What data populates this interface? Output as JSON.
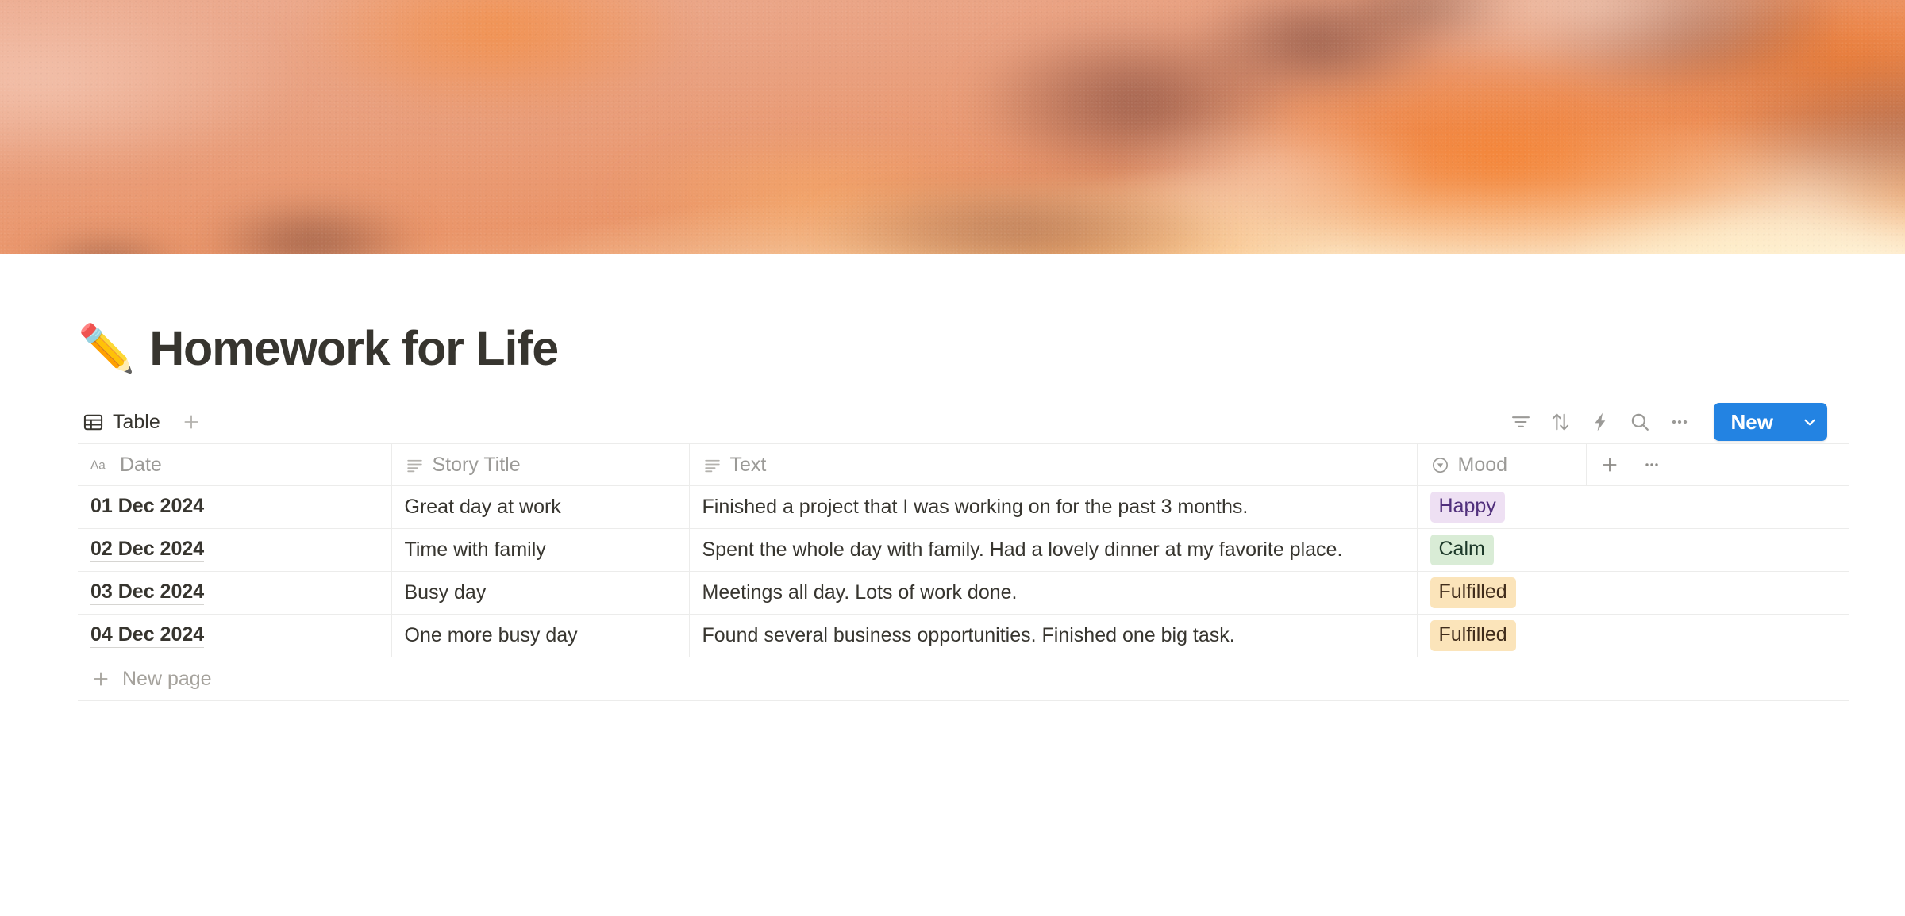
{
  "cover": {
    "name": "sunset-clouds-cover",
    "palette": [
      "#edae94",
      "#ea9569",
      "#f57e2a",
      "#8c5244",
      "#fff3d9"
    ]
  },
  "page": {
    "emoji": "✏️",
    "title": "Homework for Life"
  },
  "database": {
    "views": [
      {
        "label": "Table",
        "icon": "table-icon",
        "active": true
      }
    ],
    "add_view_icon": "plus-icon",
    "toolbar": {
      "filter_icon": "filter-icon",
      "sort_icon": "sort-arrows-icon",
      "automation_icon": "lightning-bolt-icon",
      "search_icon": "search-icon",
      "more_icon": "ellipsis-icon",
      "new_label": "New",
      "new_dropdown_icon": "chevron-down-icon",
      "accent_color": "#2383e2"
    },
    "columns": [
      {
        "label": "Date",
        "type_icon": "title-aa-icon"
      },
      {
        "label": "Story Title",
        "type_icon": "text-lines-icon"
      },
      {
        "label": "Text",
        "type_icon": "text-lines-icon"
      },
      {
        "label": "Mood",
        "type_icon": "select-circle-icon"
      }
    ],
    "add_column_icon": "plus-icon",
    "column_options_icon": "ellipsis-icon",
    "rows": [
      {
        "date": "01 Dec 2024",
        "story_title": "Great day at work",
        "text": "Finished a project that I was working on for the past 3 months.",
        "mood": {
          "label": "Happy",
          "bg": "#eee0f3",
          "fg": "#51307c"
        }
      },
      {
        "date": "02 Dec 2024",
        "story_title": "Time with family",
        "text": "Spent the whole day with family. Had a lovely dinner at my favorite place.",
        "mood": {
          "label": "Calm",
          "bg": "#d9ecd6",
          "fg": "#1c3829"
        }
      },
      {
        "date": "03 Dec 2024",
        "story_title": "Busy day",
        "text": "Meetings all day. Lots of work done.",
        "mood": {
          "label": "Fulfilled",
          "bg": "#fbe4ba",
          "fg": "#402c1b"
        }
      },
      {
        "date": "04 Dec 2024",
        "story_title": "One more busy day",
        "text": "Found several business opportunities. Finished one big task.",
        "mood": {
          "label": "Fulfilled",
          "bg": "#fbe4ba",
          "fg": "#402c1b"
        }
      }
    ],
    "new_page_label": "New page",
    "new_page_icon": "plus-icon"
  }
}
